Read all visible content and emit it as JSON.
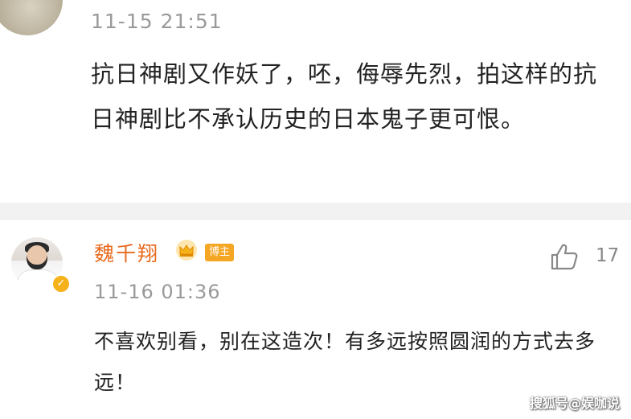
{
  "comment1": {
    "time": "11-15 21:51",
    "text": "抗日神剧又作妖了，呸，侮辱先烈，拍这样的抗日神剧比不承认历史的日本鬼子更可恨。"
  },
  "comment2": {
    "name": "魏千翔",
    "badge": "博主",
    "time": "11-16 01:36",
    "text": "不喜欢别看，别在这造次！有多远按照圆润的方式去多远！",
    "like_count": "17"
  },
  "watermark": "搜狐号@娱咖说",
  "icons": {
    "crown": "crown-icon",
    "like": "thumbs-up-icon",
    "verified": "verified-icon"
  },
  "colors": {
    "name": "#e86b1f",
    "badge": "#f5a623",
    "crown": "#f5b21b"
  }
}
